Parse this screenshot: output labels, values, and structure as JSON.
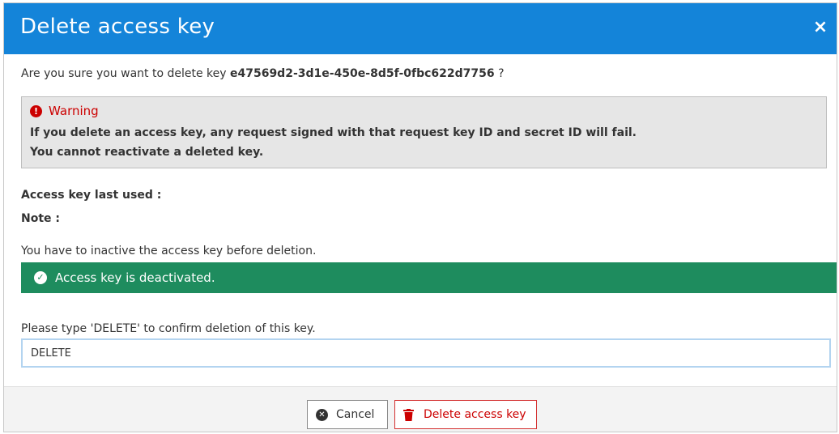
{
  "dialog": {
    "title": "Delete access key",
    "close_symbol": "×"
  },
  "confirm": {
    "prefix": "Are you sure you want to delete key",
    "key_id": "e47569d2-3d1e-450e-8d5f-0fbc622d7756",
    "suffix": "?"
  },
  "warning": {
    "icon": "exclamation-circle-icon",
    "title": "Warning",
    "line1": "If you delete an access key, any request signed with that request key ID and secret ID will fail.",
    "line2": "You cannot reactivate a deleted key."
  },
  "details": {
    "last_used_label": "Access key last used :",
    "note_label": "Note :"
  },
  "deactivate": {
    "instruction": "You have to inactive the access key before deletion.",
    "status_icon": "check-circle-icon",
    "status_text": "Access key is deactivated.",
    "status_color": "#1e8c5e"
  },
  "confirm_input": {
    "prompt": "Please type 'DELETE' to confirm deletion of this key.",
    "value": "DELETE"
  },
  "footer": {
    "cancel_label": "Cancel",
    "cancel_icon": "times-circle-icon",
    "delete_label": "Delete access key",
    "delete_icon": "trash-icon"
  },
  "colors": {
    "header": "#1484d9",
    "danger": "#cc0000",
    "success": "#1e8c5e"
  }
}
